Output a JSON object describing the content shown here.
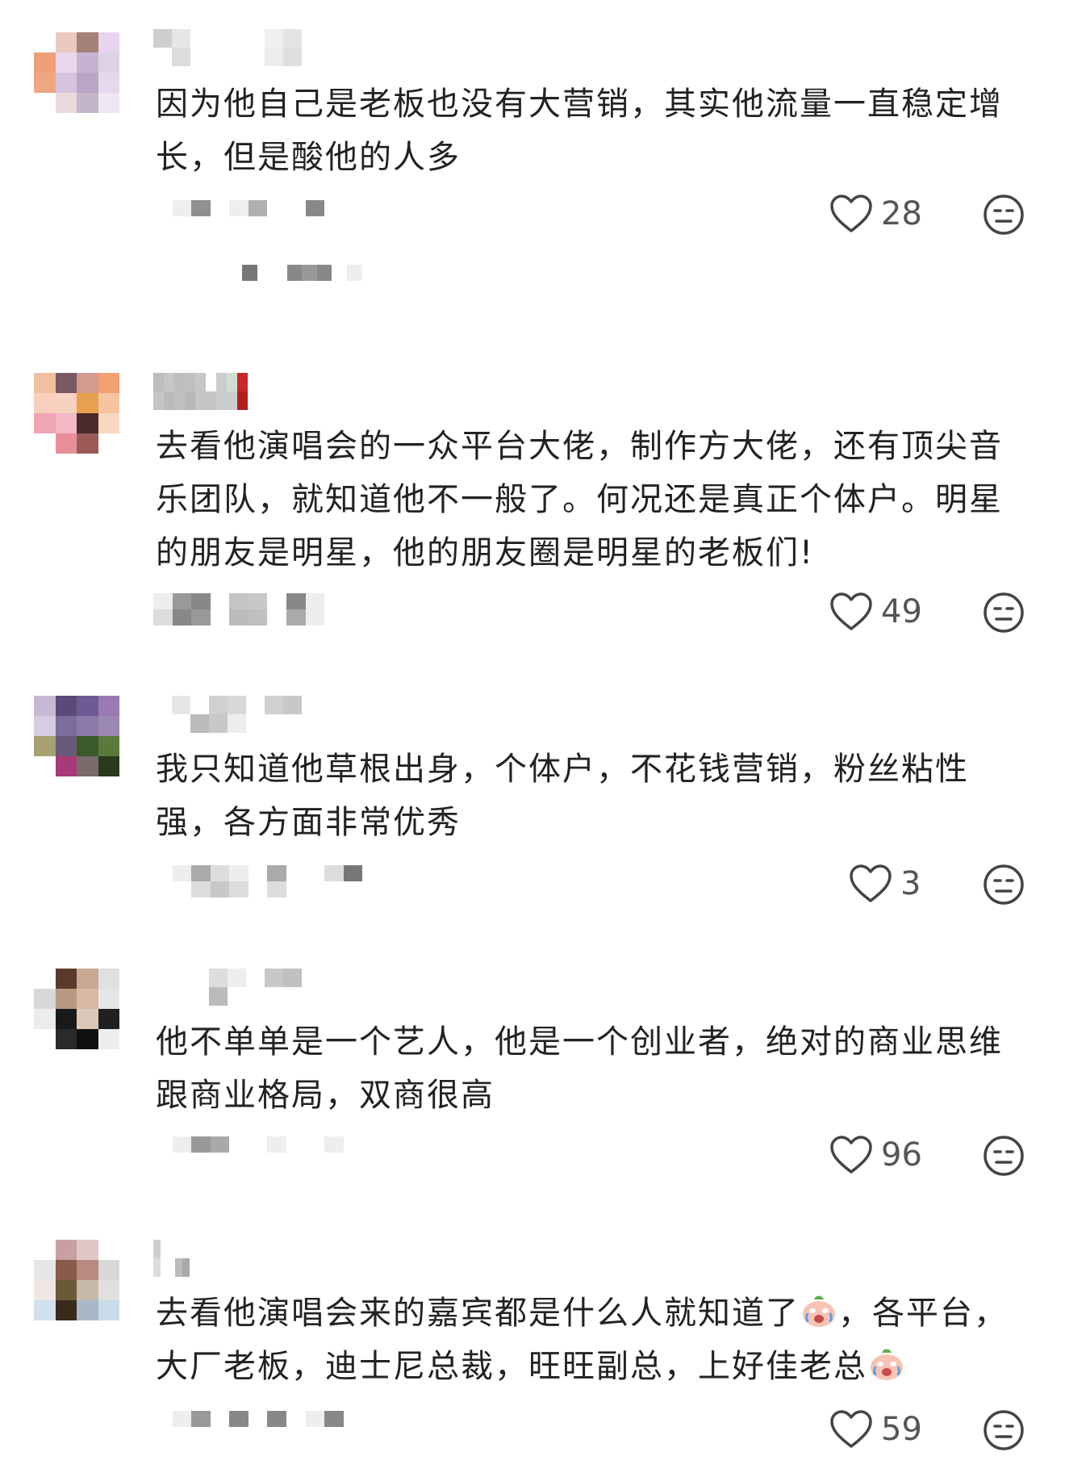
{
  "colors": {
    "text": "#222222",
    "count": "#555555",
    "icon": "#444444"
  },
  "comments": [
    {
      "text": "因为他自己是老板也没有大营销，其实他流量一直稳定增长，但是酸他的人多",
      "likes": "28"
    },
    {
      "text": "去看他演唱会的一众平台大佬，制作方大佬，还有顶尖音乐团队，就知道他不一般了。何况还是真正个体户。明星的朋友是明星，他的朋友圈是明星的老板们!",
      "likes": "49"
    },
    {
      "text": "我只知道他草根出身，个体户，不花钱营销，粉丝粘性强，各方面非常优秀",
      "likes": "3"
    },
    {
      "text": "他不单单是一个艺人，他是一个创业者，绝对的商业思维跟商业格局，双商很高",
      "likes": "96"
    },
    {
      "text_a": "去看他演唱会来的嘉宾都是什么人就知道了",
      "text_b": "，各平台，大厂老板，迪士尼总裁，旺旺副总，上好佳老总",
      "emoji": "crying-emoji",
      "likes": "59"
    }
  ]
}
